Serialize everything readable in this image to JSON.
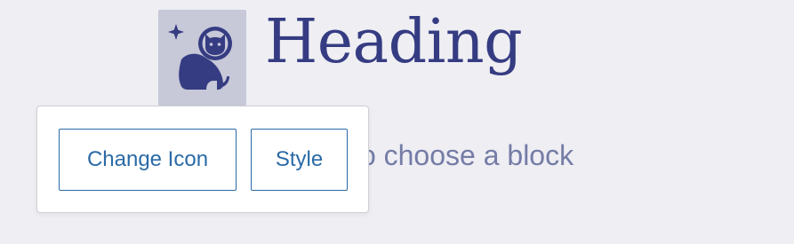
{
  "block": {
    "icon_name": "cat-astronaut-icon",
    "heading": "Heading",
    "paragraph_placeholder": "Type / to choose a block"
  },
  "toolbar": {
    "change_icon_label": "Change Icon",
    "style_label": "Style"
  },
  "colors": {
    "background": "#eeeef3",
    "icon_bg": "#c7c8d8",
    "heading": "#353c82",
    "placeholder": "#757ca6",
    "button_accent": "#2a6aa6"
  }
}
